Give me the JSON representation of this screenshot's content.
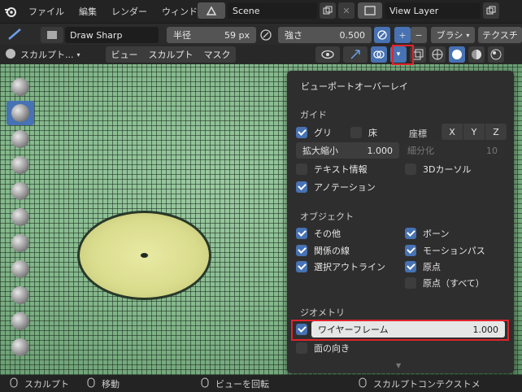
{
  "topbar": {
    "menus": [
      "ファイル",
      "編集",
      "レンダー",
      "ウィンド"
    ],
    "scene": "Scene",
    "view_layer": "View Layer"
  },
  "tool_header": {
    "brush_name": "Draw Sharp",
    "radius_label": "半径",
    "radius_value": "59 px",
    "strength_label": "強さ",
    "strength_value": "0.500",
    "plus": "+",
    "minus": "−",
    "brush_menu": "ブラシ",
    "texture_menu": "テクスチ"
  },
  "viewport_header": {
    "mode": "スカルプト...",
    "menus": [
      "ビュー",
      "スカルプト",
      "マスク"
    ]
  },
  "overlay": {
    "title": "ビューポートオーバーレイ",
    "guides": {
      "heading": "ガイド",
      "grid": "グリ",
      "floor": "床",
      "axes_label": "座標",
      "axes": [
        "X",
        "Y",
        "Z"
      ],
      "scale_label": "拡大縮小",
      "scale_value": "1.000",
      "subdiv_label": "細分化",
      "subdiv_value": "10",
      "text_info": "テキスト情報",
      "cursor_3d": "3Dカーソル",
      "annotations": "アノテーション"
    },
    "objects": {
      "heading": "オブジェクト",
      "extras": "その他",
      "bones": "ボーン",
      "relations": "関係の線",
      "motion_paths": "モーションパス",
      "outline_selected": "選択アウトライン",
      "origins": "原点",
      "origins_all": "原点（すべて）"
    },
    "geometry": {
      "heading": "ジオメトリ",
      "wireframe": "ワイヤーフレーム",
      "wireframe_value": "1.000",
      "face_orientation": "面の向き"
    }
  },
  "statusbar": {
    "left": "スカルプト",
    "middle1": "移動",
    "middle2": "ビューを回転",
    "right": "スカルプトコンテクストメ"
  },
  "colors": {
    "accent": "#4772b3",
    "highlight": "#e0242d"
  }
}
